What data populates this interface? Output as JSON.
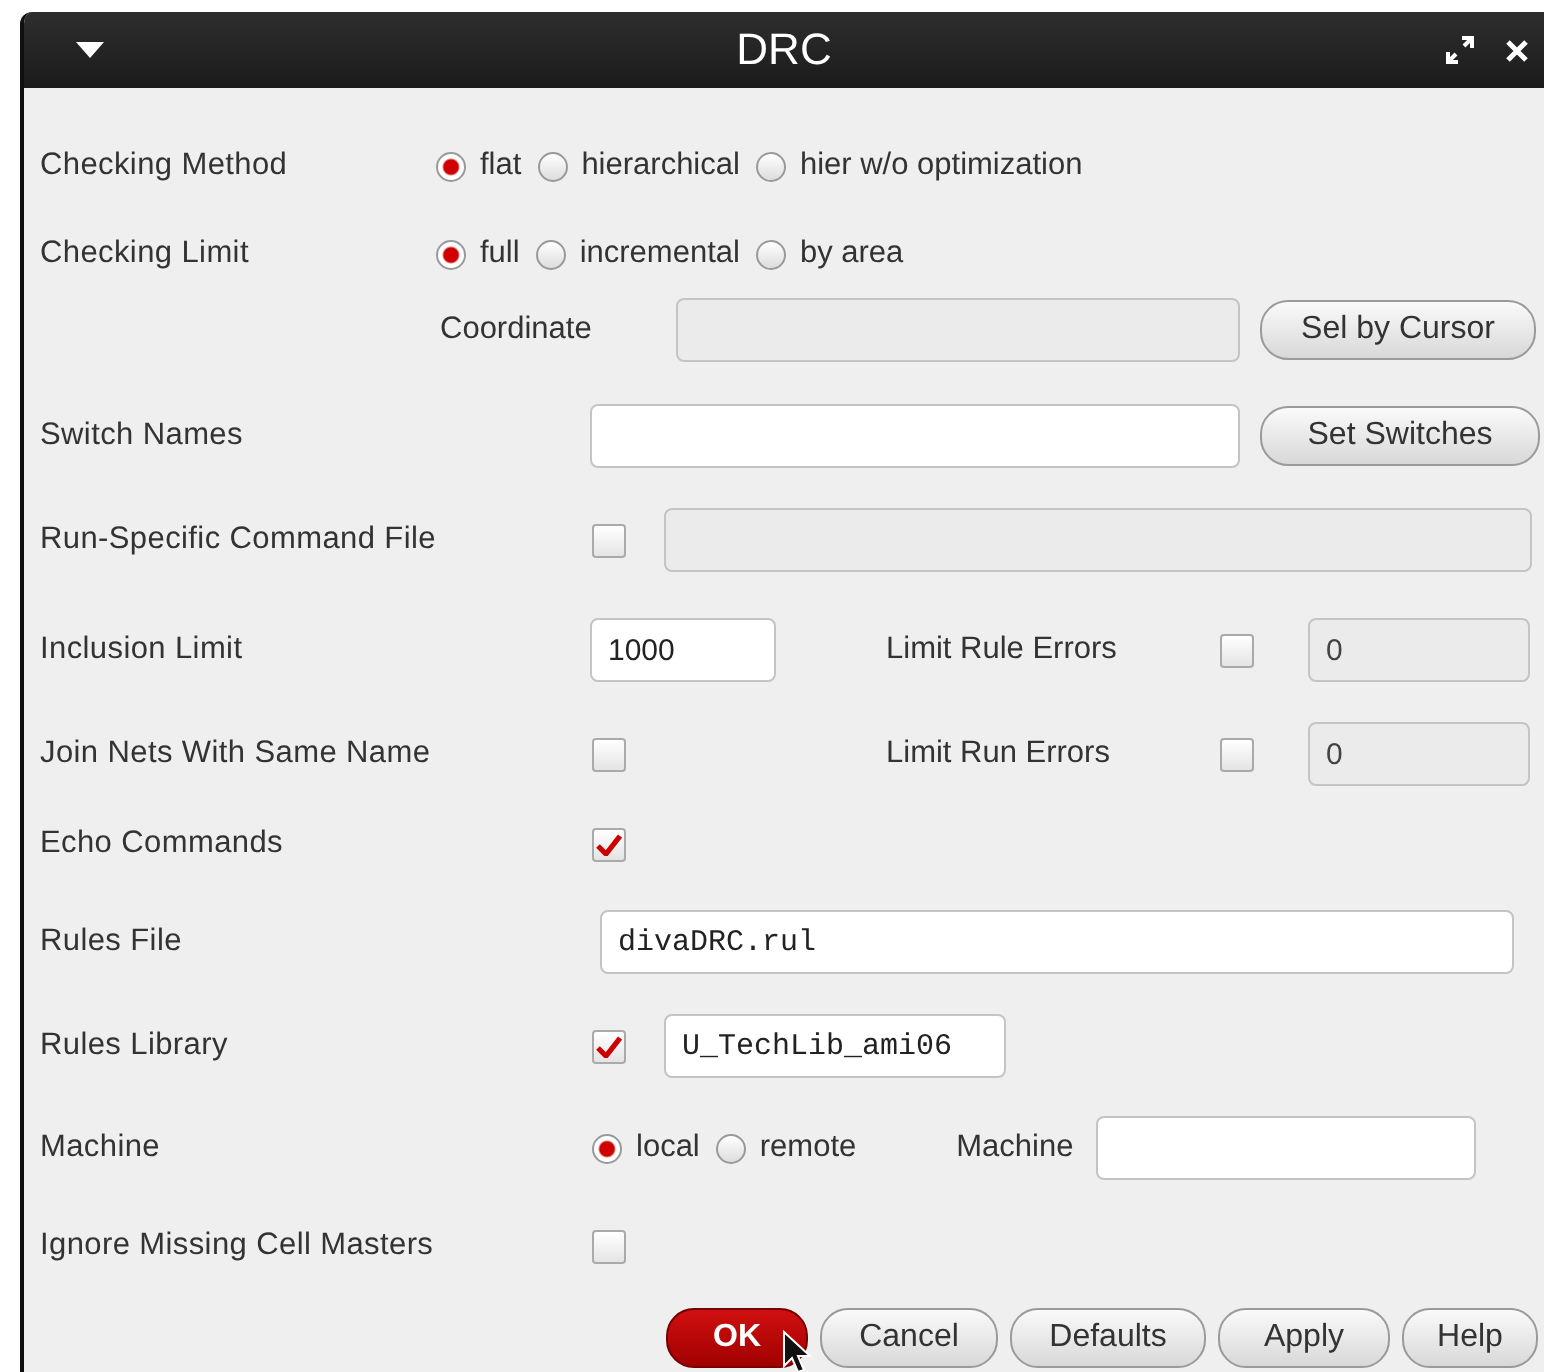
{
  "window": {
    "title": "DRC"
  },
  "checking_method": {
    "label": "Checking Method",
    "options": [
      {
        "label": "flat",
        "selected": true
      },
      {
        "label": "hierarchical",
        "selected": false
      },
      {
        "label": "hier w/o optimization",
        "selected": false
      }
    ]
  },
  "checking_limit": {
    "label": "Checking Limit",
    "options": [
      {
        "label": "full",
        "selected": true
      },
      {
        "label": "incremental",
        "selected": false
      },
      {
        "label": "by area",
        "selected": false
      }
    ]
  },
  "coordinate": {
    "label": "Coordinate",
    "disabled": true,
    "button": "Sel by Cursor"
  },
  "switch_names": {
    "label": "Switch Names",
    "disabled": false,
    "button": "Set Switches"
  },
  "run_specific": {
    "label": "Run-Specific Command File",
    "checked": false,
    "disabled": true
  },
  "inclusion_limit": {
    "label": "Inclusion Limit",
    "value": "1000"
  },
  "limit_rule_errors": {
    "label": "Limit Rule Errors",
    "checked": false,
    "value": "0",
    "disabled": true
  },
  "join_nets": {
    "label": "Join Nets With Same Name",
    "checked": false
  },
  "limit_run_errors": {
    "label": "Limit Run Errors",
    "checked": false,
    "value": "0",
    "disabled": true
  },
  "echo_commands": {
    "label": "Echo Commands",
    "checked": true
  },
  "rules_file": {
    "label": "Rules File",
    "value": "divaDRC.rul"
  },
  "rules_library": {
    "label": "Rules Library",
    "checked": true,
    "value": "U_TechLib_ami06"
  },
  "machine": {
    "label": "Machine",
    "options": [
      {
        "label": "local",
        "selected": true
      },
      {
        "label": "remote",
        "selected": false
      }
    ],
    "field_label": "Machine"
  },
  "ignore_missing": {
    "label": "Ignore Missing Cell Masters",
    "checked": false
  },
  "buttons": [
    {
      "label": "OK",
      "primary": true
    },
    {
      "label": "Cancel",
      "primary": false
    },
    {
      "label": "Defaults",
      "primary": false
    },
    {
      "label": "Apply",
      "primary": false
    },
    {
      "label": "Help",
      "primary": false
    }
  ]
}
